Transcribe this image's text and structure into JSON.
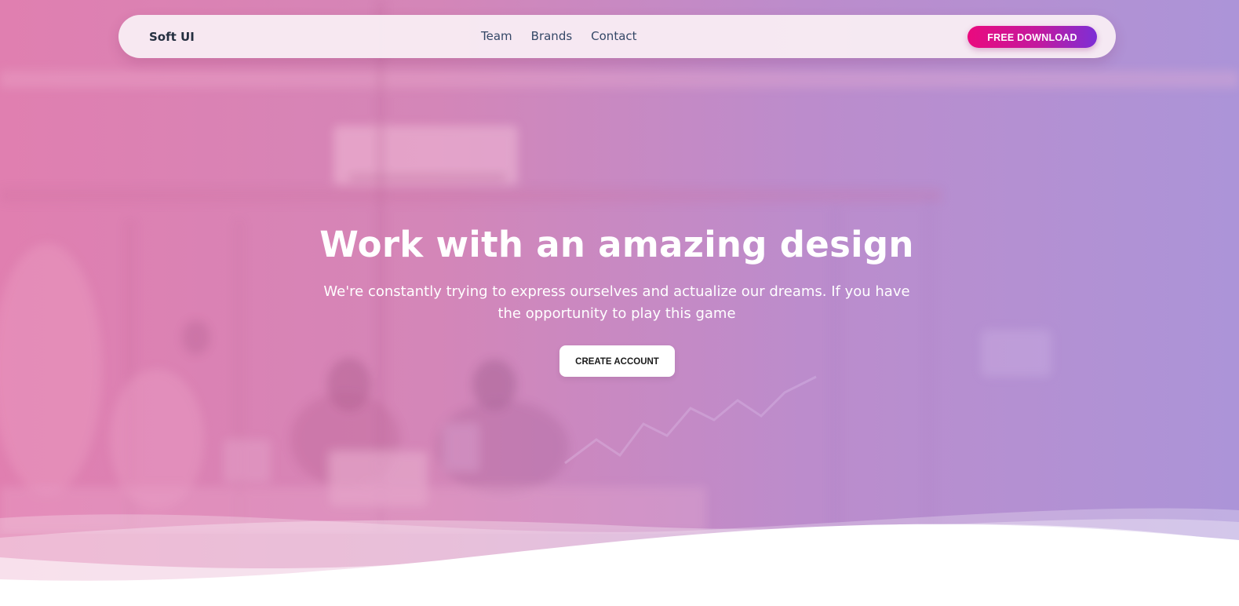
{
  "navbar": {
    "brand": "Soft UI",
    "links": [
      "Team",
      "Brands",
      "Contact"
    ],
    "cta_label": "FREE DOWNLOAD"
  },
  "hero": {
    "title": "Work with an amazing design",
    "subtitle": "We're constantly trying to express ourselves and actualize our dreams. If you have the opportunity to play this game",
    "button_label": "CREATE ACCOUNT"
  },
  "colors": {
    "gradient_start": "#e07fb0",
    "gradient_end": "#ac94d8",
    "cta_start": "#ea0a7e",
    "cta_end": "#7c2fd6",
    "text_dark": "#344767"
  }
}
